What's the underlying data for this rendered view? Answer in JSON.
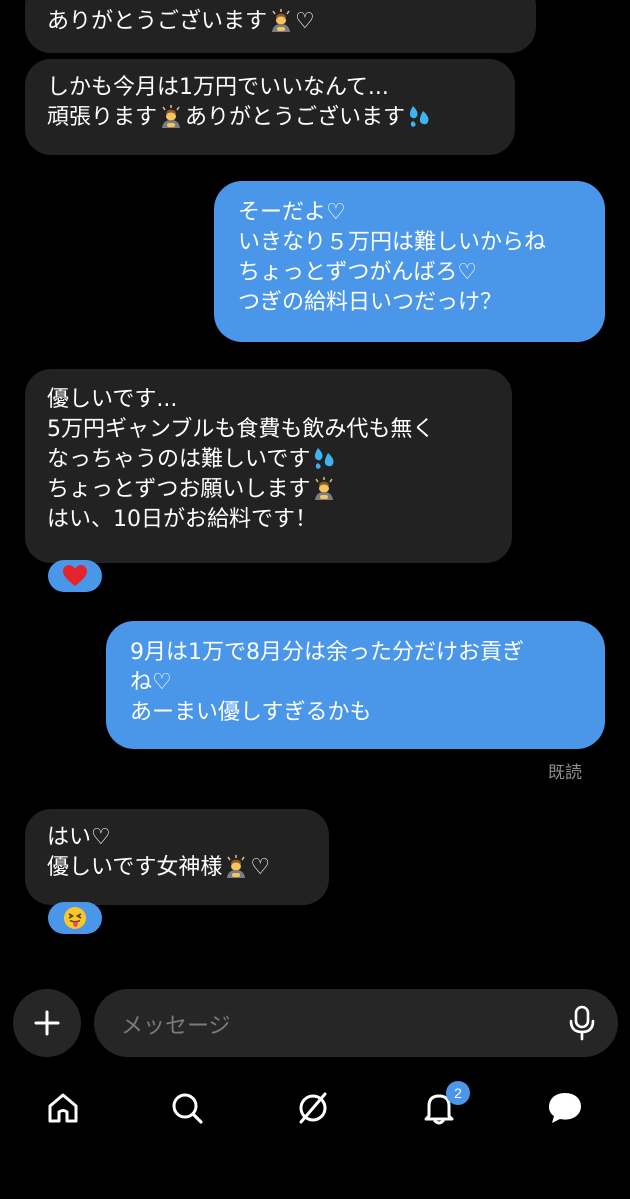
{
  "messages": [
    {
      "side": "in",
      "lines": [
        "ありがとうございます",
        "♡"
      ]
    },
    {
      "side": "in",
      "lines": [
        "しかも今月は1万円でいいなんて...",
        "頑張ります",
        "ありがとうございます"
      ]
    },
    {
      "side": "out",
      "lines": [
        "そーだよ♡",
        "いきなり５万円は難しいからね",
        "ちょっとずつがんばろ♡",
        "つぎの給料日いつだっけ？"
      ]
    },
    {
      "side": "in",
      "lines": [
        "優しいです...",
        "5万円ギャンブルも食費も飲み代も無く",
        "なっちゃうのは難しいです",
        "ちょっとずつお願いします",
        "はい、10日がお給料です！"
      ],
      "reaction": "heart"
    },
    {
      "side": "out",
      "lines": [
        "9月は1万で8月分は余った分だけお貢ぎ",
        "ね♡",
        "あーまい優しすぎるかも"
      ],
      "status": "既読"
    },
    {
      "side": "in",
      "lines": [
        "はい♡",
        "優しいです女神様",
        "♡"
      ],
      "reaction": "tongue-face"
    }
  ],
  "composer": {
    "placeholder": "メッセージ",
    "plus_icon": "plus-icon",
    "mic_icon": "microphone-icon"
  },
  "nav": {
    "items": [
      {
        "icon": "home-icon"
      },
      {
        "icon": "search-icon"
      },
      {
        "icon": "explore-icon"
      },
      {
        "icon": "bell-icon",
        "badge": "2"
      },
      {
        "icon": "chat-bubble-icon"
      }
    ]
  },
  "colors": {
    "outgoing_bubble": "#4a97e9",
    "incoming_bubble": "#222222",
    "background": "#000000"
  }
}
